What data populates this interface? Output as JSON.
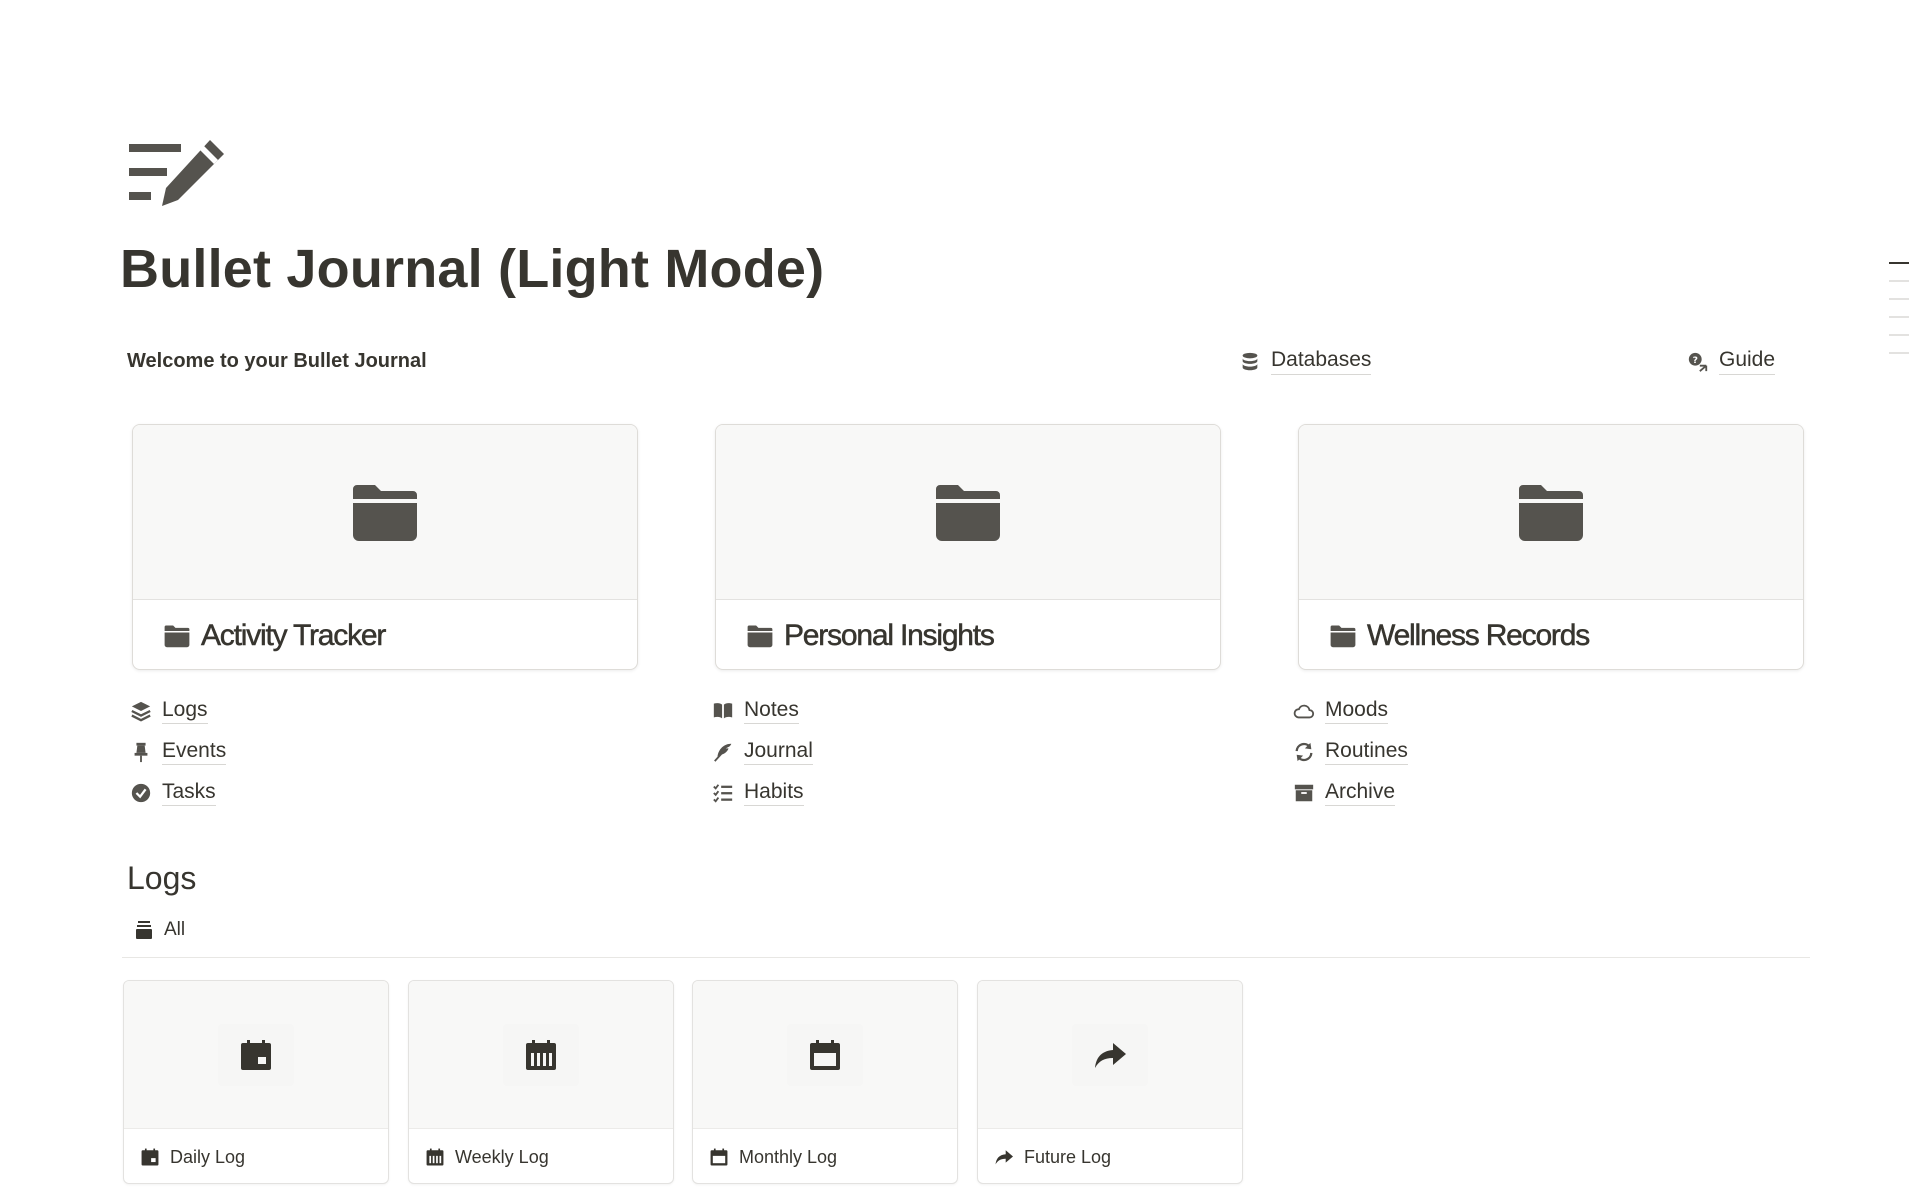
{
  "page": {
    "title": "Bullet Journal (Light Mode)",
    "icon": "notes-pencil-icon",
    "welcome": "Welcome to your Bullet Journal"
  },
  "links": {
    "databases": {
      "label": "Databases",
      "icon": "database-icon"
    },
    "guide": {
      "label": "Guide",
      "icon": "guide-icon"
    }
  },
  "sections": [
    {
      "title": "Activity Tracker",
      "icon": "folder-icon",
      "items": [
        {
          "label": "Logs",
          "icon": "layers-icon"
        },
        {
          "label": "Events",
          "icon": "pin-icon"
        },
        {
          "label": "Tasks",
          "icon": "check-circle-icon"
        }
      ]
    },
    {
      "title": "Personal Insights",
      "icon": "folder-icon",
      "items": [
        {
          "label": "Notes",
          "icon": "book-open-icon"
        },
        {
          "label": "Journal",
          "icon": "feather-icon"
        },
        {
          "label": "Habits",
          "icon": "checklist-icon"
        }
      ]
    },
    {
      "title": "Wellness Records",
      "icon": "folder-icon",
      "items": [
        {
          "label": "Moods",
          "icon": "cloud-icon"
        },
        {
          "label": "Routines",
          "icon": "refresh-icon"
        },
        {
          "label": "Archive",
          "icon": "archive-icon"
        }
      ]
    }
  ],
  "logs": {
    "heading": "Logs",
    "view_tab": {
      "label": "All",
      "icon": "stack-icon"
    },
    "cards": [
      {
        "label": "Daily Log",
        "icon": "calendar-day-icon"
      },
      {
        "label": "Weekly Log",
        "icon": "calendar-week-icon"
      },
      {
        "label": "Monthly Log",
        "icon": "calendar-month-icon"
      },
      {
        "label": "Future Log",
        "icon": "forward-arrow-icon"
      }
    ]
  },
  "colors": {
    "text": "#37352f",
    "icon": "#55534e",
    "cover_bg": "#f8f8f7",
    "border": "#e3e2e0"
  }
}
